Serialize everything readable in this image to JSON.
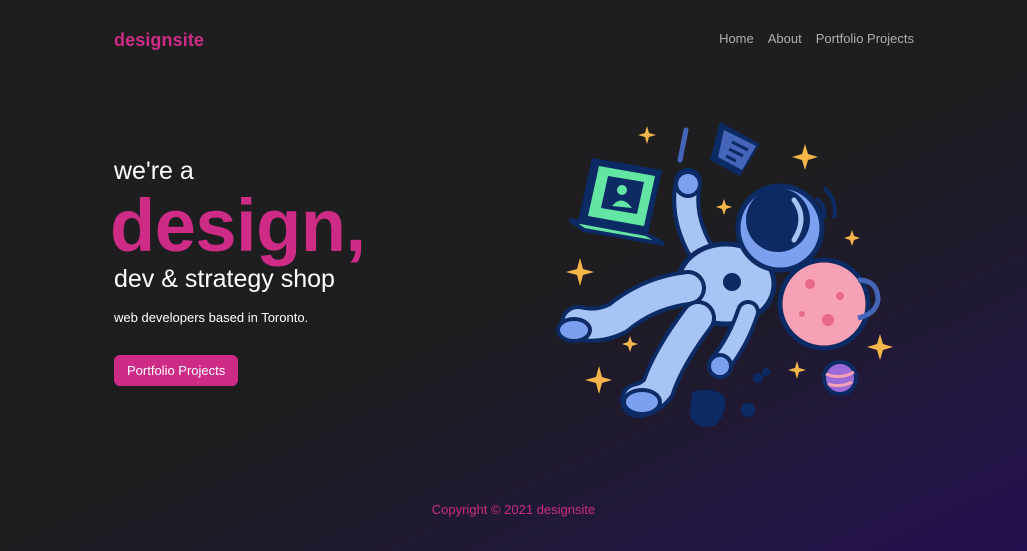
{
  "brand": {
    "name": "designsite",
    "accent_color": "#ce2b86"
  },
  "nav": {
    "items": [
      {
        "label": "Home"
      },
      {
        "label": "About"
      },
      {
        "label": "Portfolio Projects"
      }
    ]
  },
  "hero": {
    "intro": "we're a",
    "headline": "design,",
    "subheadline": "dev & strategy shop",
    "description": "web developers based in Toronto.",
    "cta_label": "Portfolio Projects"
  },
  "illustration": {
    "icon": "astronaut-illustration"
  },
  "footer": {
    "copyright": "Copyright © 2021 designsite"
  }
}
